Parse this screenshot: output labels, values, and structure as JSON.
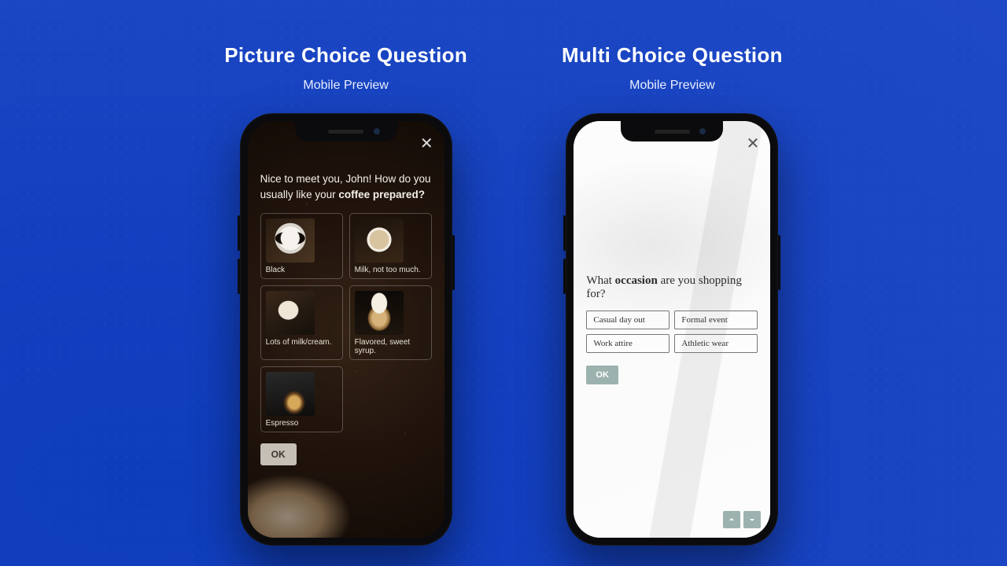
{
  "left": {
    "title": "Picture Choice Question",
    "subtitle": "Mobile Preview",
    "question_pre": "Nice to meet you, John! How do you usually like your ",
    "question_bold": "coffee prepared?",
    "options": [
      {
        "label": "Black",
        "icon": "t-black"
      },
      {
        "label": "Milk, not too much.",
        "icon": "t-milk"
      },
      {
        "label": "Lots of milk/cream.",
        "icon": "t-lots"
      },
      {
        "label": "Flavored, sweet syrup.",
        "icon": "t-flav"
      },
      {
        "label": "Espresso",
        "icon": "t-esp"
      }
    ],
    "ok": "OK"
  },
  "right": {
    "title": "Multi Choice Question",
    "subtitle": "Mobile Preview",
    "question_pre": "What ",
    "question_bold": "occasion",
    "question_post": " are you shopping for?",
    "options": [
      "Casual day out",
      "Formal event",
      "Work attire",
      "Athletic wear"
    ],
    "ok": "OK"
  },
  "icons": {
    "close": "✕",
    "up": "chevron-up",
    "down": "chevron-down"
  }
}
